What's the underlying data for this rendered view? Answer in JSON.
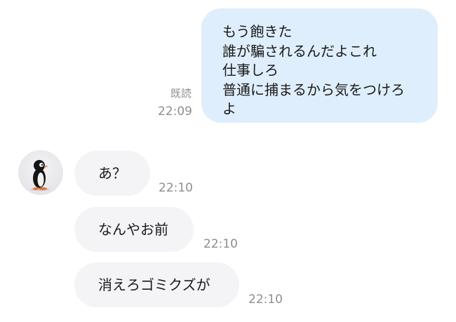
{
  "outgoing": {
    "lines": [
      "もう飽きた",
      "誰が騙されるんだよこれ",
      "仕事しろ",
      "普通に捕まるから気をつけろ",
      "よ"
    ],
    "read_label": "既読",
    "time": "22:09"
  },
  "incoming": {
    "avatar": "penguin-avatar",
    "messages": [
      {
        "text": "あ？",
        "time": "22:10"
      },
      {
        "text": "なんやお前",
        "time": "22:10"
      },
      {
        "text": "消えろゴミクズが",
        "time": "22:10"
      }
    ]
  },
  "colors": {
    "outgoing_bubble": "#dfeefc",
    "incoming_bubble": "#f4f4f6",
    "meta_text": "#8e8e93"
  }
}
